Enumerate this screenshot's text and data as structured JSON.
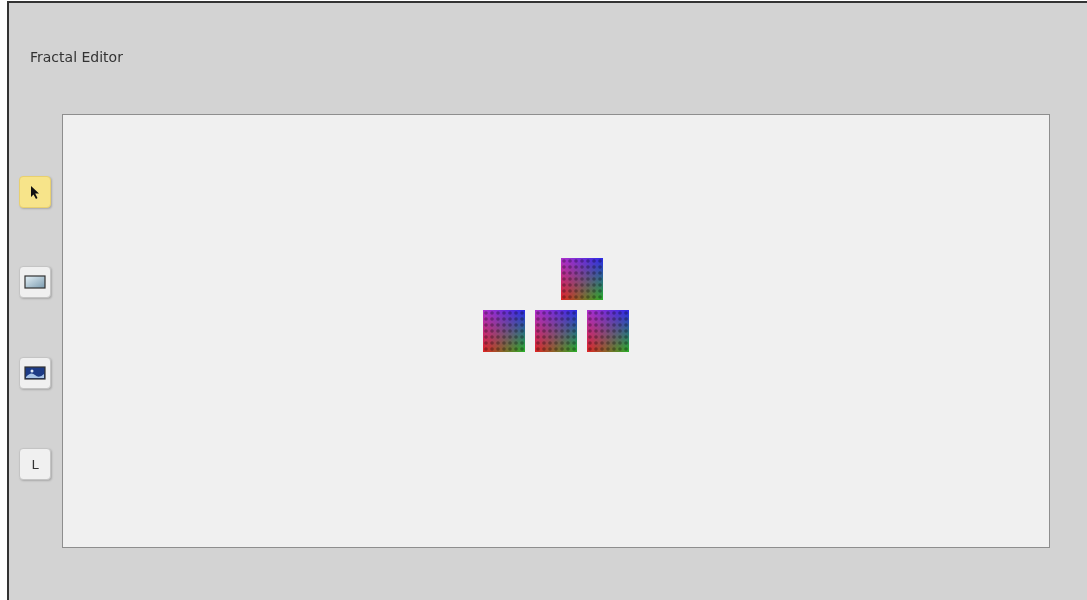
{
  "window": {
    "title": "Fractal Editor"
  },
  "tools": [
    {
      "kind": "pointer",
      "selected": true
    },
    {
      "kind": "rectangle",
      "selected": false
    },
    {
      "kind": "image",
      "selected": false
    },
    {
      "kind": "letter",
      "label": "L",
      "selected": false
    }
  ]
}
